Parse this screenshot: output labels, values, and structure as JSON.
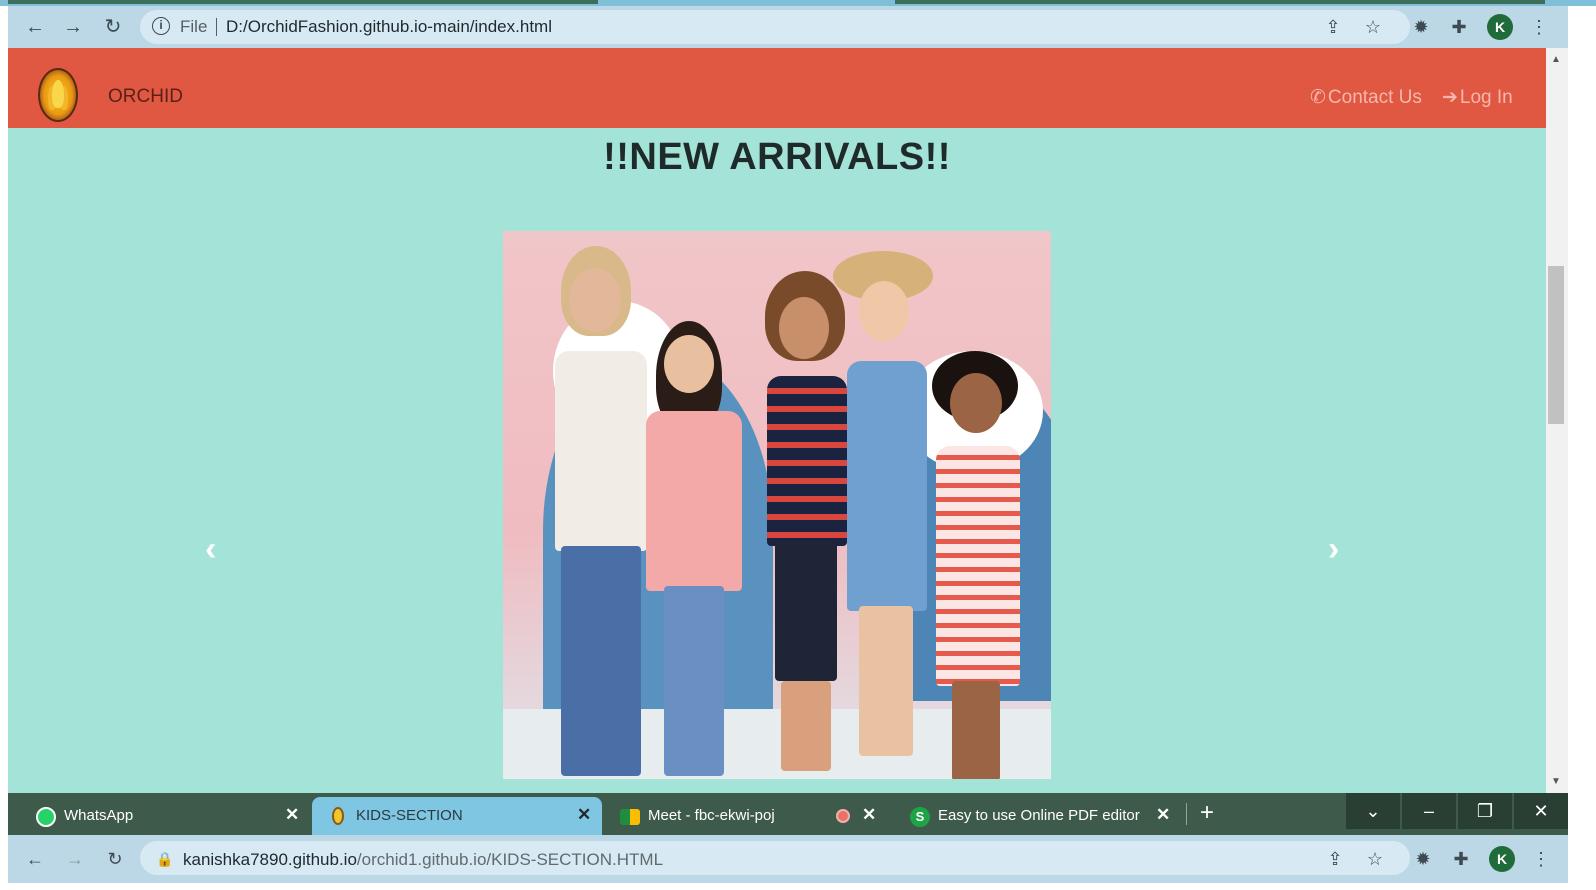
{
  "browser_top": {
    "file_label": "File",
    "url": "D:/OrchidFashion.github.io-main/index.html",
    "avatar_letter": "K"
  },
  "page": {
    "brand": "ORCHID",
    "contact_label": "Contact Us",
    "login_label": "Log In",
    "heading": "!!NEW ARRIVALS!!",
    "prev_arrow": "‹",
    "next_arrow": "›",
    "colors": {
      "navbar": "#e05842",
      "background": "#a4e3d8"
    }
  },
  "browser_bottom": {
    "tabs": [
      {
        "title": "WhatsApp",
        "close": "✕"
      },
      {
        "title": "KIDS-SECTION",
        "close": "✕"
      },
      {
        "title": "Meet - fbc-ekwi-poj",
        "close": "✕"
      },
      {
        "title": "Easy to use Online PDF editor",
        "close": "✕"
      }
    ],
    "new_tab": "+",
    "url_host": "kanishka7890.github.io",
    "url_path": "/orchid1.github.io/KIDS-SECTION.HTML",
    "avatar_letter": "K"
  }
}
